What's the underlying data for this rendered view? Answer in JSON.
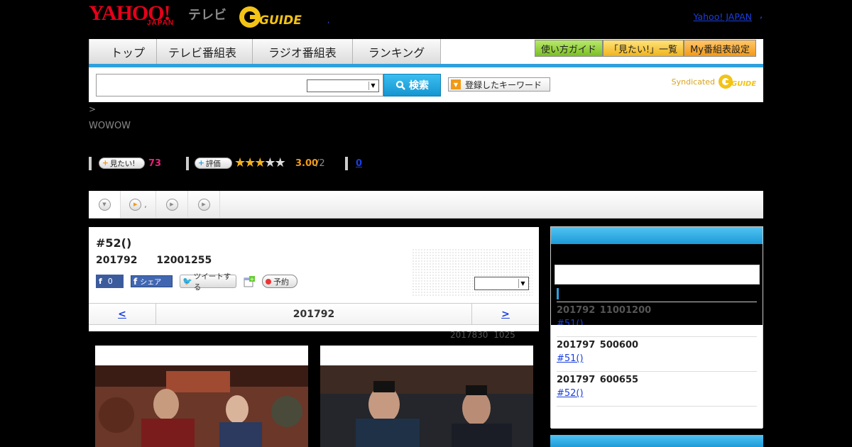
{
  "header": {
    "logo_yahoo": "YAHOO!",
    "logo_japan": "JAPAN",
    "logo_tv": "テレビ",
    "logo_gguide": "GUIDE",
    "dot": ",",
    "yahoo_japan_link": "Yahoo! JAPAN",
    "trailing_dot": ","
  },
  "nav": {
    "tabs": [
      "トップ",
      "テレビ番組表",
      "ラジオ番組表",
      "ランキング"
    ],
    "right_buttons": [
      "使い方ガイド",
      "「見たい!」一覧",
      "My番組表設定"
    ]
  },
  "search": {
    "value": "",
    "select_value": "",
    "button_label": "検索",
    "keyword_button_label": "登録したキーワード",
    "syndicated_label": "Syndicated",
    "syndicated_brand": "GUIDE"
  },
  "program": {
    "breadcrumb": ">",
    "channel": "WOWOW",
    "want_label": "見たい!",
    "want_count": "73",
    "rate_label": "評価",
    "rating_value": 3.0,
    "rating_max": 5,
    "rating": "3.00",
    "rating_of": "/2",
    "review_count": "0"
  },
  "tabs": {
    "t2_label": ","
  },
  "episode": {
    "title": "#52()",
    "datetime": "201792 12001255",
    "fb_count": "0",
    "fb_share": "シェア",
    "tweet": "ツイートする",
    "reserve": "予約",
    "select_value": "",
    "pager_prev": "<",
    "pager_date": "201792",
    "pager_next": ">",
    "updated": "2017830 1025"
  },
  "sidebar": {
    "items": [
      {
        "when": "201792 11001200",
        "ep": "#51()"
      },
      {
        "when": "201797 500600",
        "ep": "#51()"
      },
      {
        "when": "201797 600655",
        "ep": "#52()"
      }
    ]
  },
  "colors": {
    "accent_blue": "#2ea0de",
    "link": "#1a3fe0",
    "want_pink": "#e8217b",
    "rating_orange": "#f09a16"
  }
}
